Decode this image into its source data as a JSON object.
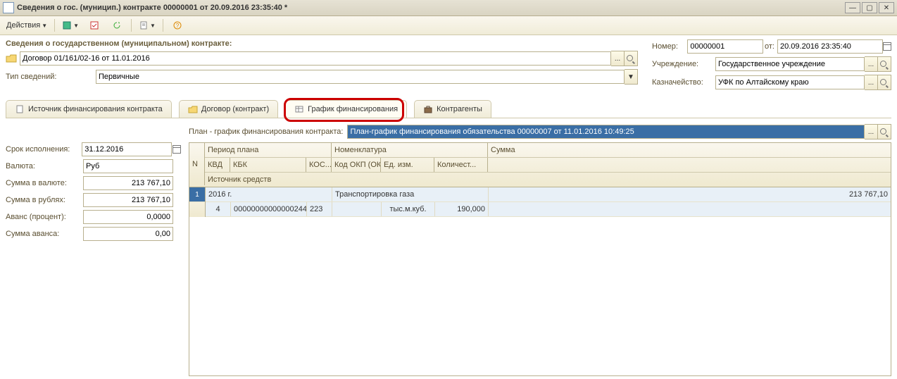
{
  "window": {
    "title": "Сведения о гос. (муницип.) контракте 00000001 от 20.09.2016 23:35:40 *"
  },
  "toolbar": {
    "actions_label": "Действия"
  },
  "section_title": "Сведения о государственном (муниципальном) контракте:",
  "main": {
    "contract_text": "Договор 01/161/02-16 от 11.01.2016",
    "type_label": "Тип сведений:",
    "type_value": "Первичные"
  },
  "right": {
    "number_label": "Номер:",
    "number_value": "00000001",
    "from_label": "от:",
    "date_value": "20.09.2016 23:35:40",
    "org_label": "Учреждение:",
    "org_value": "Государственное учреждение",
    "treasury_label": "Казначейство:",
    "treasury_value": "УФК по Алтайскому краю"
  },
  "tabs": {
    "t1": "Источник финансирования контракта",
    "t2": "Договор (контракт)",
    "t3": "График финансирования",
    "t4": "Контрагенты"
  },
  "params": {
    "plan_label": "План - график финансирования контракта:",
    "plan_value": "План-график финансирования обязательства 00000007 от 11.01.2016 10:49:25",
    "due_label": "Срок исполнения:",
    "due_value": "31.12.2016",
    "currency_label": "Валюта:",
    "currency_value": "Руб",
    "sum_cur_label": "Сумма в валюте:",
    "sum_cur_value": "213 767,10",
    "sum_rub_label": "Сумма в рублях:",
    "sum_rub_value": "213 767,10",
    "advance_pct_label": "Аванс (процент):",
    "advance_pct_value": "0,0000",
    "advance_sum_label": "Сумма аванса:",
    "advance_sum_value": "0,00"
  },
  "grid": {
    "headers": {
      "n": "N",
      "period": "Период плана",
      "nomen": "Номенклатура",
      "sum": "Сумма",
      "kvd": "КВД",
      "kbk": "КБК",
      "kos": "КОС...",
      "okp": "Код ОКП (ОКДП, ...",
      "ed": "Ед. изм.",
      "qty": "Количест...",
      "src": "Источник средств"
    },
    "row": {
      "n": "1",
      "period": "2016 г.",
      "nomen": "Транспортировка газа",
      "sum": "213 767,10",
      "kvd": "4",
      "kbk": "00000000000000244",
      "kos": "223",
      "okp": "",
      "ed": "тыс.м.куб.",
      "qty": "190,000"
    }
  }
}
